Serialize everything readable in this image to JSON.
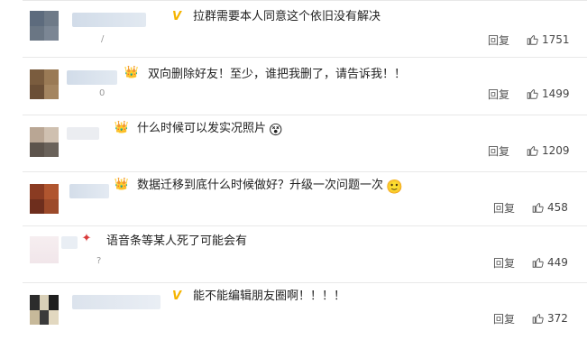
{
  "comments": [
    {
      "text": "拉群需要本人同意这个依旧没有解决",
      "badge": "V",
      "emoji": "",
      "reply": "回复",
      "likes": "1751",
      "faint": ""
    },
    {
      "text": "双向删除好友！至少，谁把我删了，请告诉我！！",
      "badge": "👑",
      "emoji": "",
      "reply": "回复",
      "likes": "1499",
      "faint": "0"
    },
    {
      "text": "什么时候可以发实况照片",
      "badge": "👑",
      "emoji": "😵",
      "reply": "回复",
      "likes": "1209",
      "faint": ""
    },
    {
      "text": "数据迁移到底什么时候做好？升级一次问题一次",
      "badge": "👑",
      "emoji": "🙂",
      "reply": "回复",
      "likes": "458",
      "faint": ""
    },
    {
      "text": "语音条等某人死了可能会有",
      "badge": "✦",
      "emoji": "",
      "reply": "回复",
      "likes": "449",
      "faint": "?"
    },
    {
      "text": "能不能编辑朋友圈啊！！！！",
      "badge": "V",
      "emoji": "",
      "reply": "回复",
      "likes": "372",
      "faint": ""
    }
  ],
  "colors": {
    "v_badge": "#f5b400",
    "crown": "#f0a020",
    "red_badge": "#d93b3b"
  }
}
